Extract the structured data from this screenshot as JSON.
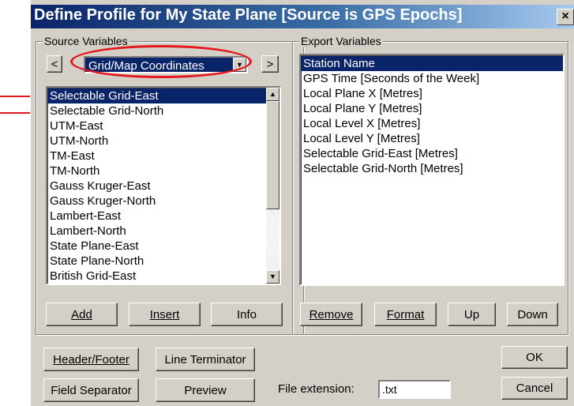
{
  "window": {
    "title": "Define Profile for My State Plane [Source is GPS Epochs]",
    "close_glyph": "×"
  },
  "source": {
    "label": "Source Variables",
    "category": "Grid/Map Coordinates",
    "prev_glyph": "<",
    "next_glyph": ">",
    "items": [
      "Selectable Grid-East",
      "Selectable Grid-North",
      "UTM-East",
      "UTM-North",
      "TM-East",
      "TM-North",
      "Gauss Kruger-East",
      "Gauss Kruger-North",
      "Lambert-East",
      "Lambert-North",
      "State Plane-East",
      "State Plane-North",
      "British Grid-East"
    ],
    "selected_index": 0,
    "buttons": {
      "add": "Add",
      "insert": "Insert",
      "info": "Info"
    }
  },
  "export": {
    "label": "Export Variables",
    "items": [
      "Station Name",
      "GPS Time [Seconds of the Week]",
      "Local Plane X [Metres]",
      "Local Plane Y [Metres]",
      "Local Level X [Metres]",
      "Local Level Y [Metres]",
      "Selectable Grid-East [Metres]",
      "Selectable Grid-North [Metres]"
    ],
    "selected_index": 0,
    "buttons": {
      "remove": "Remove",
      "format": "Format",
      "up": "Up",
      "down": "Down"
    }
  },
  "bottom": {
    "header_footer": "Header/Footer",
    "line_terminator": "Line Terminator",
    "field_separator": "Field Separator",
    "preview": "Preview",
    "file_extension_label": "File extension:",
    "file_extension_value": ".txt",
    "ok": "OK",
    "cancel": "Cancel"
  },
  "icons": {
    "scroll_up": "scroll-up-arrow-icon",
    "scroll_down": "scroll-down-arrow-icon",
    "dropdown": "chevron-down-icon"
  },
  "colors": {
    "title_bar": "#0a246a",
    "selection": "#0a246a",
    "annotation": "#e3171d",
    "dialog_bg": "#d4d0c8"
  }
}
